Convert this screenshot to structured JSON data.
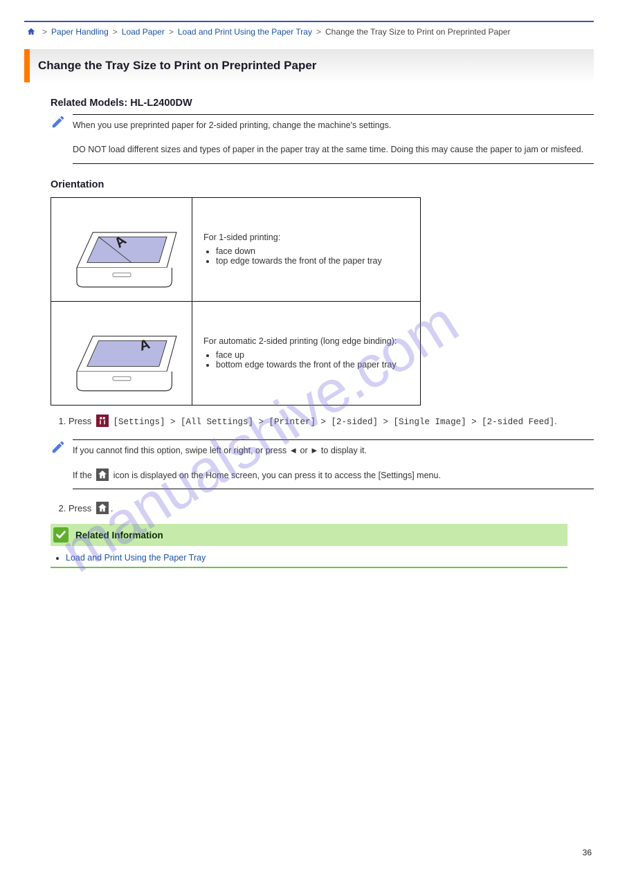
{
  "breadcrumb": {
    "home_label": "Home",
    "sep": ">",
    "items": [
      "Paper Handling",
      "Load Paper",
      "Load and Print Using the Paper Tray",
      "Change the Tray Size to Print on Preprinted Paper"
    ]
  },
  "title": "Change the Tray Size to Print on Preprinted Paper",
  "subhead": "Related Models: HL-L2400DW",
  "note1": "When you use preprinted paper for 2-sided printing, change the machine's settings.",
  "note1b": "DO NOT load different sizes and types of paper in the paper tray at the same time. Doing this may cause the paper to jam or misfeed.",
  "orientation_heading": "Orientation",
  "table": {
    "row1_caption": "For 1-sided printing:",
    "row1_bullets": [
      "face down",
      "top edge towards the front of the paper tray"
    ],
    "row2_caption": "For automatic 2-sided printing (long edge binding):",
    "row2_bullets": [
      "face up",
      "bottom edge towards the front of the paper tray"
    ]
  },
  "steps": {
    "s1_press": "Press",
    "s1_seq": "[Settings] > [All Settings] > [Printer] > [2-sided] > [Single Image] > [2-sided Feed]",
    "s1_period": ".",
    "s2": "Press",
    "s2_period": "."
  },
  "note2_line1": "If you cannot find this option, swipe left or right, or press ◄ or ► to display it.",
  "note2_line2_a": "If the",
  "note2_line2_b": "icon is displayed on the Home screen, you can press it to access the [Settings] menu.",
  "note2_line2_c": "",
  "related": {
    "heading": "Related Information",
    "link": "Load and Print Using the Paper Tray"
  },
  "page": "36",
  "watermark": "manualshive.com",
  "icons": {
    "settings": "settings-icon",
    "home": "home-icon"
  }
}
